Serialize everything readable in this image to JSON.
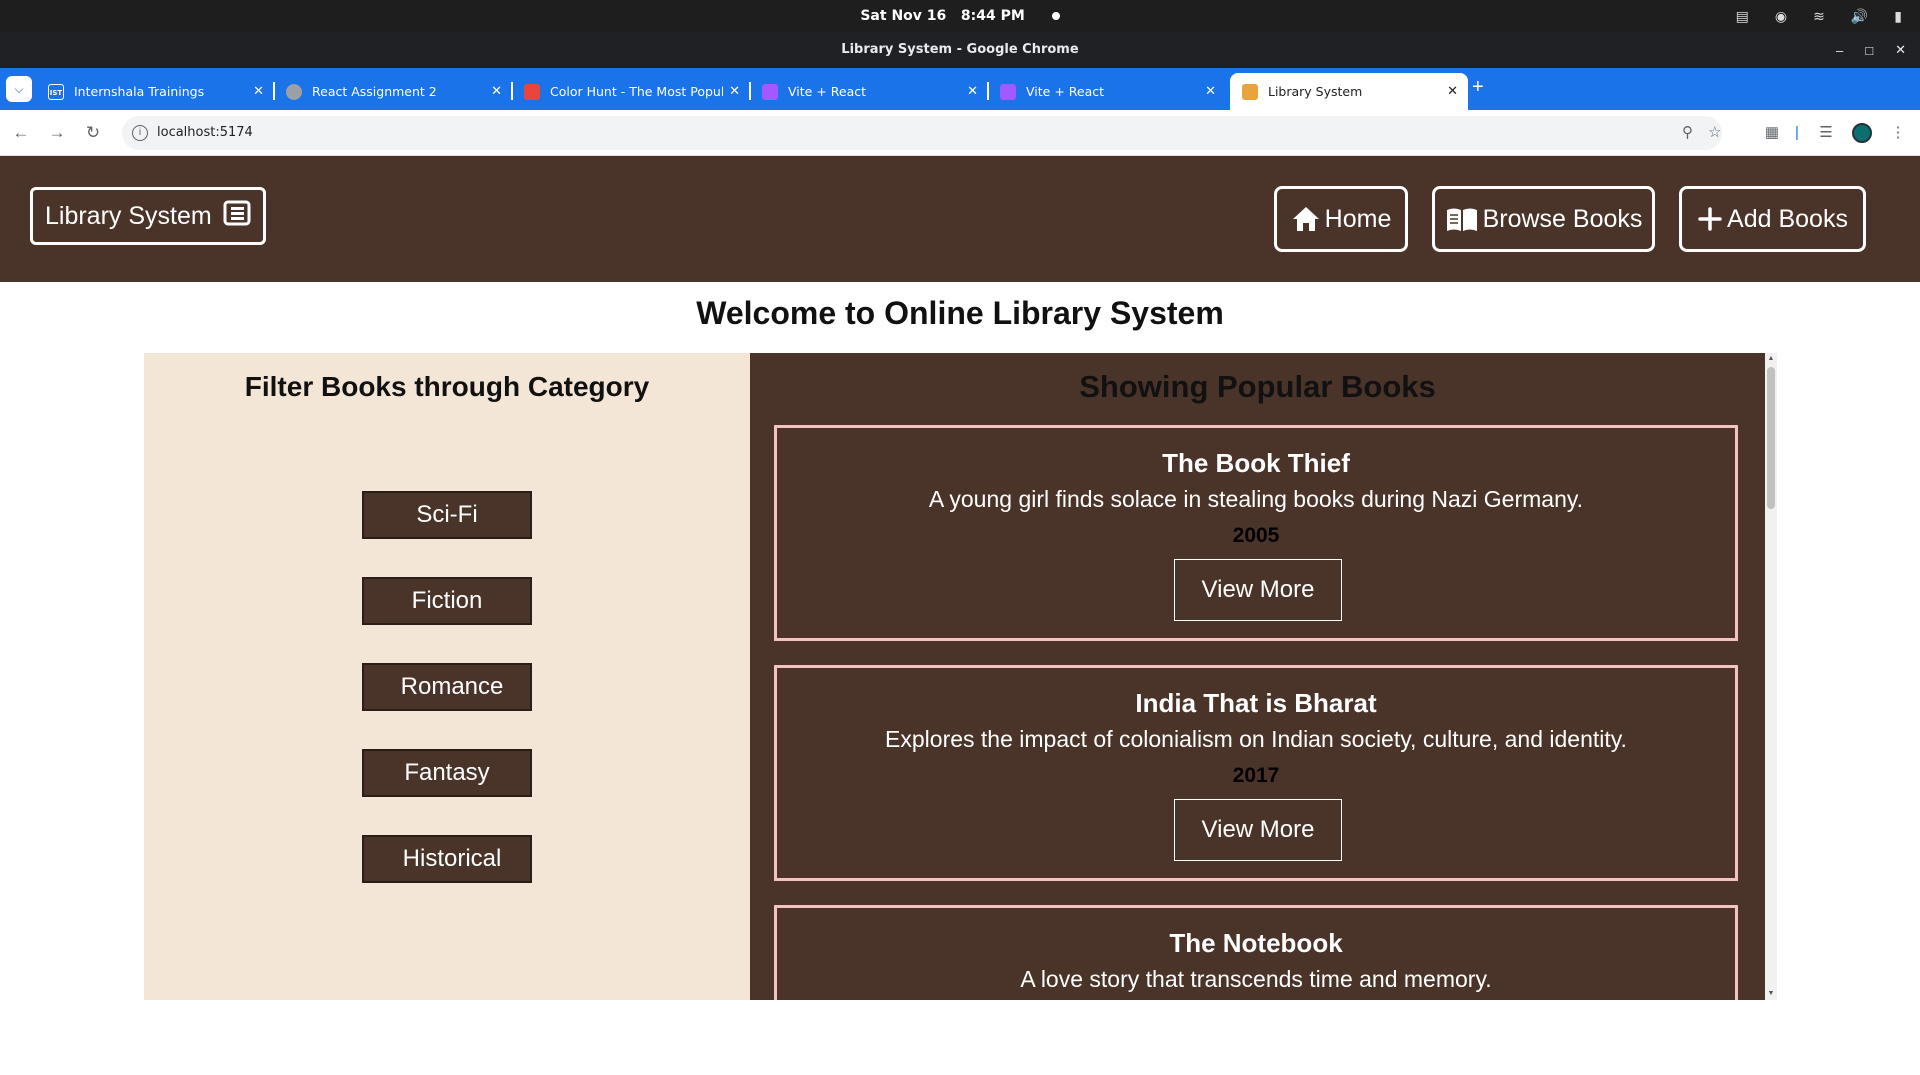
{
  "system_bar": {
    "date": "Sat Nov 16",
    "time": "8:44 PM"
  },
  "window": {
    "title": "Library System - Google Chrome"
  },
  "tabs": [
    {
      "label": "Internshala Trainings",
      "favicon_text": "IST",
      "favicon_color": "#1a73e8"
    },
    {
      "label": "React Assignment 2",
      "favicon_text": "",
      "favicon_color": "#9aa0a6"
    },
    {
      "label": "Color Hunt - The Most Popul",
      "favicon_text": "",
      "favicon_color": "#e8453c"
    },
    {
      "label": "Vite + React",
      "favicon_text": "",
      "favicon_color": "#a259ff"
    },
    {
      "label": "Vite + React",
      "favicon_text": "",
      "favicon_color": "#a259ff"
    },
    {
      "label": "Library System",
      "favicon_text": "",
      "favicon_color": "#e8a33c",
      "active": true
    }
  ],
  "toolbar": {
    "url": "localhost:5174"
  },
  "app": {
    "brand": "Library System",
    "nav": {
      "home": "Home",
      "browse": "Browse Books",
      "add": "Add Books"
    },
    "welcome": "Welcome to Online Library System",
    "filter": {
      "title": "Filter Books through Category",
      "categories": [
        "Sci-Fi",
        "Fiction",
        "Romance",
        "Fantasy",
        "Historical"
      ]
    },
    "popular": {
      "title": "Showing Popular Books",
      "view_more_label": "View More",
      "books": [
        {
          "title": "The Book Thief",
          "description": "A young girl finds solace in stealing books during Nazi Germany.",
          "year": "2005"
        },
        {
          "title": "India That is Bharat",
          "description": "Explores the impact of colonialism on Indian society, culture, and identity.",
          "year": "2017"
        },
        {
          "title": "The Notebook",
          "description": "A love story that transcends time and memory.",
          "year": ""
        }
      ]
    }
  },
  "colors": {
    "header_bg": "#4a3429",
    "filter_bg": "#f3e6d6",
    "card_border": "#f4c2c2",
    "chrome_tabstrip": "#1a73e8"
  }
}
